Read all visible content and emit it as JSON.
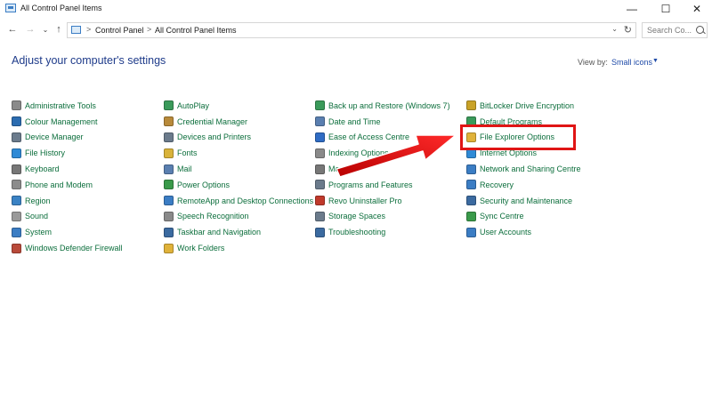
{
  "window": {
    "title": "All Control Panel Items",
    "minimize": "—",
    "maximize": "☐",
    "close": "✕"
  },
  "nav": {
    "back": "←",
    "forward": "→",
    "recent": "⌄",
    "up": "↑"
  },
  "address": {
    "crumbs": [
      "Control Panel",
      "All Control Panel Items"
    ],
    "separator": ">",
    "dropdown": "⌄",
    "refresh": "↻"
  },
  "search": {
    "placeholder": "Search Co..."
  },
  "heading": "Adjust your computer's settings",
  "view_by": {
    "label": "View by:",
    "value": "Small icons",
    "dropdown": "▼"
  },
  "columns": [
    {
      "items": [
        {
          "label": "Administrative Tools",
          "icon": "admin-tools-icon",
          "color": "#8a8a8a"
        },
        {
          "label": "Colour Management",
          "icon": "colour-management-icon",
          "color": "#2b6cb0"
        },
        {
          "label": "Device Manager",
          "icon": "device-manager-icon",
          "color": "#6b7b8c"
        },
        {
          "label": "File History",
          "icon": "file-history-icon",
          "color": "#2f8ad6"
        },
        {
          "label": "Keyboard",
          "icon": "keyboard-icon",
          "color": "#777777"
        },
        {
          "label": "Phone and Modem",
          "icon": "phone-modem-icon",
          "color": "#8c8c8c"
        },
        {
          "label": "Region",
          "icon": "region-icon",
          "color": "#3a82c4"
        },
        {
          "label": "Sound",
          "icon": "sound-icon",
          "color": "#9a9a9a"
        },
        {
          "label": "System",
          "icon": "system-icon",
          "color": "#3b7dc4"
        },
        {
          "label": "Windows Defender Firewall",
          "icon": "firewall-icon",
          "color": "#b94a3a"
        }
      ]
    },
    {
      "items": [
        {
          "label": "AutoPlay",
          "icon": "autoplay-icon",
          "color": "#3a9a5a"
        },
        {
          "label": "Credential Manager",
          "icon": "credential-manager-icon",
          "color": "#b88a3a"
        },
        {
          "label": "Devices and Printers",
          "icon": "devices-printers-icon",
          "color": "#6b7b8c"
        },
        {
          "label": "Fonts",
          "icon": "fonts-icon",
          "color": "#d9b33a"
        },
        {
          "label": "Mail",
          "icon": "mail-icon",
          "color": "#5a7fb0"
        },
        {
          "label": "Power Options",
          "icon": "power-options-icon",
          "color": "#3a9a4a"
        },
        {
          "label": "RemoteApp and Desktop Connections",
          "icon": "remoteapp-icon",
          "color": "#3b7dc4"
        },
        {
          "label": "Speech Recognition",
          "icon": "speech-recognition-icon",
          "color": "#8a8a8a"
        },
        {
          "label": "Taskbar and Navigation",
          "icon": "taskbar-icon",
          "color": "#3b6aa0"
        },
        {
          "label": "Work Folders",
          "icon": "work-folders-icon",
          "color": "#e0b23a"
        }
      ]
    },
    {
      "items": [
        {
          "label": "Back up and Restore (Windows 7)",
          "icon": "backup-restore-icon",
          "color": "#3a9a5a"
        },
        {
          "label": "Date and Time",
          "icon": "date-time-icon",
          "color": "#5a7fb0"
        },
        {
          "label": "Ease of Access Centre",
          "icon": "ease-of-access-icon",
          "color": "#2f6cc4"
        },
        {
          "label": "Indexing Options",
          "icon": "indexing-options-icon",
          "color": "#8a8a8a"
        },
        {
          "label": "Mouse",
          "icon": "mouse-icon",
          "color": "#777777"
        },
        {
          "label": "Programs and Features",
          "icon": "programs-features-icon",
          "color": "#6b7b8c"
        },
        {
          "label": "Revo Uninstaller Pro",
          "icon": "revo-uninstaller-icon",
          "color": "#c0392b"
        },
        {
          "label": "Storage Spaces",
          "icon": "storage-spaces-icon",
          "color": "#6b7b8c"
        },
        {
          "label": "Troubleshooting",
          "icon": "troubleshooting-icon",
          "color": "#3b6aa0"
        }
      ]
    },
    {
      "items": [
        {
          "label": "BitLocker Drive Encryption",
          "icon": "bitlocker-icon",
          "color": "#c9a227"
        },
        {
          "label": "Default Programs",
          "icon": "default-programs-icon",
          "color": "#3a9a5a"
        },
        {
          "label": "File Explorer Options",
          "icon": "file-explorer-options-icon",
          "color": "#e0b23a"
        },
        {
          "label": "Internet Options",
          "icon": "internet-options-icon",
          "color": "#2f8ad6"
        },
        {
          "label": "Network and Sharing Centre",
          "icon": "network-sharing-icon",
          "color": "#3b7dc4"
        },
        {
          "label": "Recovery",
          "icon": "recovery-icon",
          "color": "#3b7dc4"
        },
        {
          "label": "Security and Maintenance",
          "icon": "security-maintenance-icon",
          "color": "#3b6aa0"
        },
        {
          "label": "Sync Centre",
          "icon": "sync-centre-icon",
          "color": "#3a9a4a"
        },
        {
          "label": "User Accounts",
          "icon": "user-accounts-icon",
          "color": "#3b7dc4"
        }
      ]
    }
  ],
  "annotation": {
    "color": "#e01515"
  }
}
